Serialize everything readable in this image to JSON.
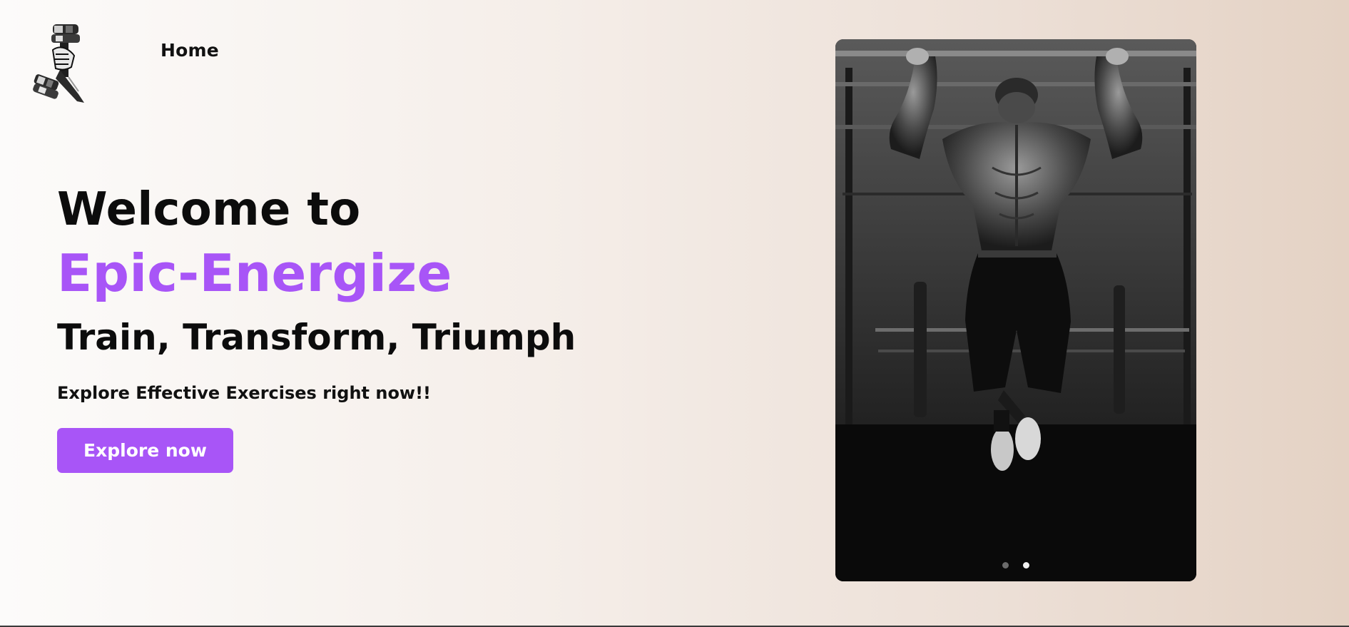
{
  "header": {
    "logo_icon": "dumbbell-fist-logo",
    "nav_home_label": "Home"
  },
  "hero": {
    "welcome": "Welcome to",
    "brand": "Epic-Energize",
    "tagline": "Train, Transform, Triumph",
    "subtitle": "Explore Effective Exercises right now!!",
    "cta_label": "Explore now"
  },
  "carousel": {
    "slide_count": 2,
    "active_slide": 2
  },
  "colors": {
    "accent": "#a855f7",
    "text": "#0c0c0c",
    "bg_start": "#fcfbfa",
    "bg_end": "#e4d2c4"
  }
}
